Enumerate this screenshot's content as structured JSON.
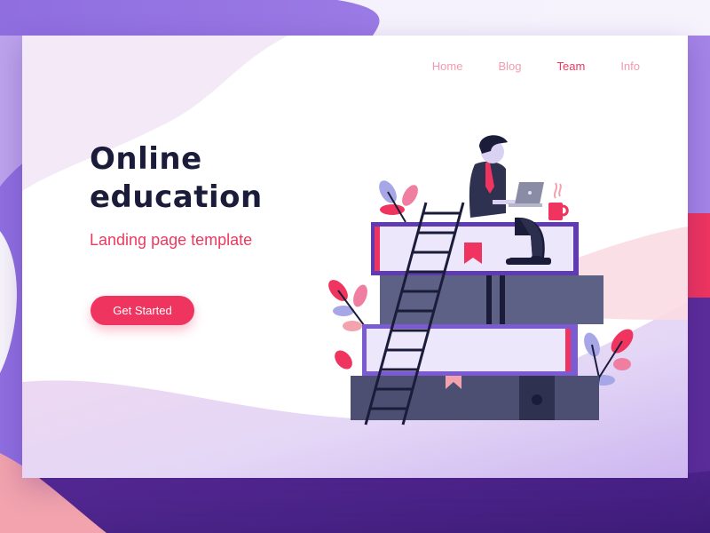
{
  "nav": {
    "items": [
      {
        "label": "Home"
      },
      {
        "label": "Blog"
      },
      {
        "label": "Team"
      },
      {
        "label": "Info"
      }
    ],
    "active": "Team"
  },
  "hero": {
    "title_line1": "Online",
    "title_line2": "education",
    "subtitle": "Landing page template",
    "cta_label": "Get Started"
  },
  "colors": {
    "accent": "#ef355f",
    "heading": "#1b1c3a",
    "background_purple": "#7b4fd0",
    "book_dark": "#4c4f72"
  },
  "icons": [
    "bookmark-icon",
    "coffee-cup-icon",
    "laptop-icon",
    "plant-leaf-icon",
    "ladder-icon"
  ]
}
